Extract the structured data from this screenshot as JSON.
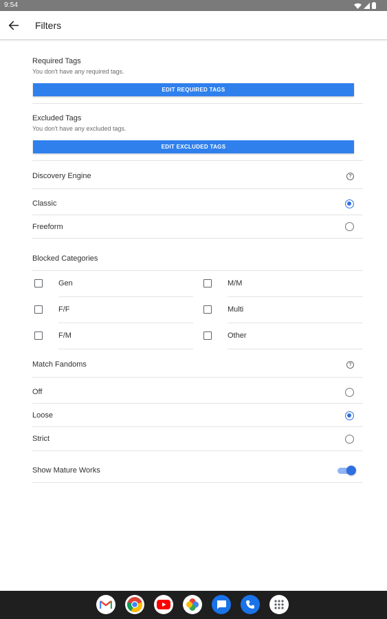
{
  "status_bar": {
    "time": "9:54"
  },
  "app_bar": {
    "title": "Filters"
  },
  "required_tags": {
    "title": "Required Tags",
    "subtitle": "You don't have any required tags.",
    "button": "EDIT REQUIRED TAGS"
  },
  "excluded_tags": {
    "title": "Excluded Tags",
    "subtitle": "You don't have any excluded tags.",
    "button": "EDIT EXCLUDED TAGS"
  },
  "discovery_engine": {
    "title": "Discovery Engine",
    "help_glyph": "?",
    "options": [
      {
        "label": "Classic",
        "selected": true
      },
      {
        "label": "Freeform",
        "selected": false
      }
    ]
  },
  "blocked_categories": {
    "title": "Blocked Categories",
    "items": [
      {
        "label": "Gen",
        "checked": false
      },
      {
        "label": "M/M",
        "checked": false
      },
      {
        "label": "F/F",
        "checked": false
      },
      {
        "label": "Multi",
        "checked": false
      },
      {
        "label": "F/M",
        "checked": false
      },
      {
        "label": "Other",
        "checked": false
      }
    ]
  },
  "match_fandoms": {
    "title": "Match Fandoms",
    "help_glyph": "?",
    "options": [
      {
        "label": "Off",
        "selected": false
      },
      {
        "label": "Loose",
        "selected": true
      },
      {
        "label": "Strict",
        "selected": false
      }
    ]
  },
  "show_mature": {
    "label": "Show Mature Works",
    "enabled": true
  },
  "dock": {
    "apps": [
      "gmail-icon",
      "chrome-icon",
      "youtube-icon",
      "photos-icon",
      "messages-icon",
      "phone-icon",
      "app-drawer-icon"
    ]
  },
  "colors": {
    "accent": "#2f6fe0",
    "button": "#2f80ed",
    "status_bar": "#7a7a7a",
    "nav_bar": "#1f1f1f"
  }
}
